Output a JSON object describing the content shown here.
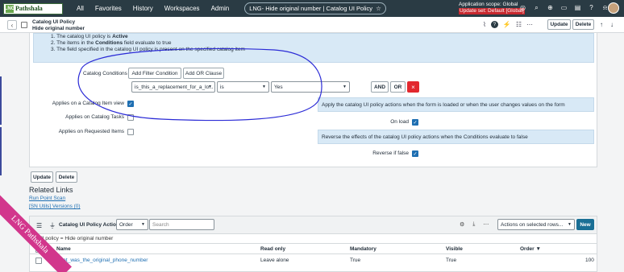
{
  "nav": {
    "logo_mark": "LNG",
    "logo_text": "Pathshala",
    "links": [
      "All",
      "Favorites",
      "History",
      "Workspaces",
      "Admin"
    ],
    "pill_title": "LNG- Hide original number | Catalog UI Policy",
    "star": "☆",
    "scope_line1": "Application scope: Global",
    "scope_line2": "Update set: Default [Global]"
  },
  "form_header": {
    "type": "Catalog UI Policy",
    "name": "Hide original number",
    "update_label": "Update",
    "delete_label": "Delete"
  },
  "info": {
    "line1_prefix": "1. The catalog UI policy is ",
    "line1_bold": "Active",
    "line2_prefix": "2. The items in the ",
    "line2_bold": "Conditions",
    "line2_suffix": " field evaluate to true",
    "line3": "3. The field specified in the catalog UI policy is present on the specified catalog item"
  },
  "conditions": {
    "label": "Catalog Conditions",
    "add_filter_label": "Add Filter Condition",
    "add_or_label": "Add OR Clause",
    "field_value": "is_this_a_replacement_for_a_lo...",
    "operator_value": "is",
    "value_value": "Yes",
    "and_label": "AND",
    "or_label": "OR",
    "remove_label": "×"
  },
  "fields": {
    "applies_view_label": "Applies on a Catalog Item view",
    "applies_view_checked": true,
    "applies_tasks_label": "Applies on Catalog Tasks",
    "applies_tasks_checked": false,
    "applies_requested_label": "Applies on Requested Items",
    "applies_requested_checked": false,
    "help_apply": "Apply the catalog UI policy actions when the form is loaded or when the user changes values on the form",
    "onload_label": "On load",
    "onload_checked": true,
    "help_reverse": "Reverse the effects of the catalog UI policy actions when the Conditions evaluate to false",
    "reverse_label": "Reverse if false",
    "reverse_checked": true
  },
  "bottom_buttons": {
    "update_label": "Update",
    "delete_label": "Delete"
  },
  "related_links": {
    "heading": "Related Links",
    "links": [
      "Run Point Scan",
      "[SN Utils] Versions (0)"
    ]
  },
  "related_list": {
    "title": "Catalog UI Policy Actions",
    "search_field": "Order",
    "search_placeholder": "Search",
    "actions_label": "Actions on selected rows...",
    "new_label": "New",
    "breadcrumb": "UI policy = Hide original number",
    "columns": [
      "Name",
      "Read only",
      "Mandatory",
      "Visible",
      "Order ▼"
    ],
    "rows": [
      [
        "what_was_the_original_phone_number",
        "Leave alone",
        "True",
        "True",
        "100"
      ]
    ]
  },
  "watermark": "LNG Pathshala",
  "colors": {
    "nav_bg": "#2a3b44",
    "info_bg": "#d8e9f6",
    "accent": "#1f6fb2",
    "remove": "#e2282e",
    "new_button": "#1a6f95",
    "annotation": "#2b2bd6",
    "ribbon": "#d2368c"
  }
}
